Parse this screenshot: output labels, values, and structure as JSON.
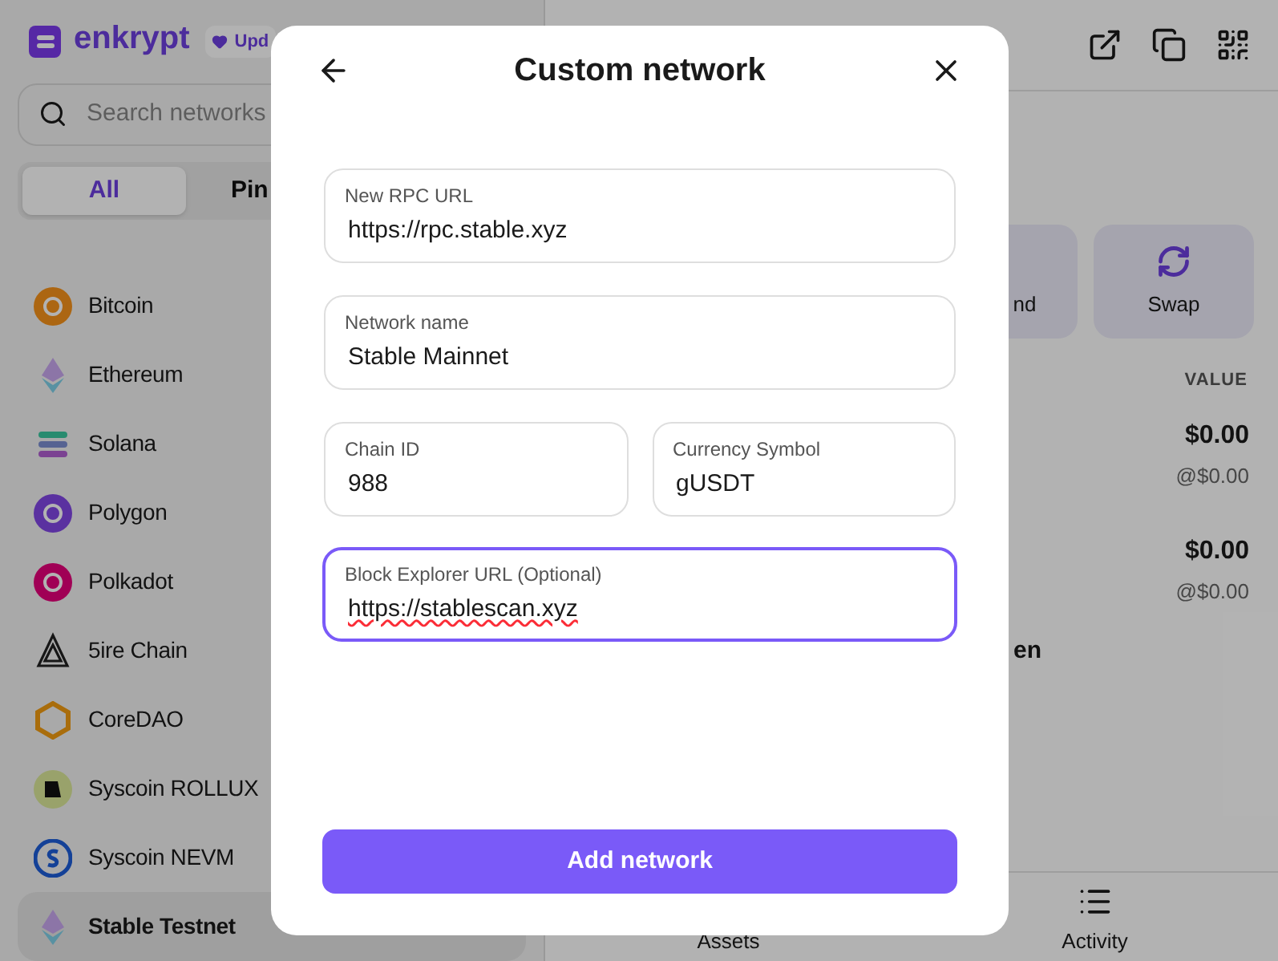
{
  "sidebar": {
    "logo": "enkrypt",
    "update_badge": "Upd",
    "search": {
      "placeholder": "Search networks"
    },
    "tabs": [
      {
        "label": "All",
        "selected": true
      },
      {
        "label": "Pin",
        "selected": false
      }
    ],
    "networks": [
      {
        "name": "Bitcoin",
        "selected": false
      },
      {
        "name": "Ethereum",
        "selected": false
      },
      {
        "name": "Solana",
        "selected": false
      },
      {
        "name": "Polygon",
        "selected": false
      },
      {
        "name": "Polkadot",
        "selected": false
      },
      {
        "name": "5ire Chain",
        "selected": false
      },
      {
        "name": "CoreDAO",
        "selected": false
      },
      {
        "name": "Syscoin ROLLUX",
        "selected": false
      },
      {
        "name": "Syscoin NEVM",
        "selected": false
      },
      {
        "name": "Stable Testnet",
        "selected": true
      }
    ]
  },
  "main": {
    "actions": [
      "nd",
      "Swap"
    ],
    "value_header": "VALUE",
    "assets": [
      {
        "value": "$0.00",
        "price": "@$0.00"
      },
      {
        "value": "$0.00",
        "price": "@$0.00"
      }
    ],
    "token_name_fragment": "en",
    "bottom_nav": [
      "Assets",
      "Activity"
    ]
  },
  "dialog": {
    "title": "Custom network",
    "rows": [
      [
        {
          "label": "New RPC URL",
          "value": "https://rpc.stable.xyz",
          "focused": false
        }
      ],
      [
        {
          "label": "Network name",
          "value": "Stable Mainnet",
          "focused": false
        }
      ],
      [
        {
          "label": "Chain ID",
          "value": "988",
          "focused": false
        },
        {
          "label": "Currency Symbol",
          "value": "gUSDT",
          "focused": false
        }
      ],
      [
        {
          "label": "Block Explorer URL (Optional)",
          "value": "https://stablescan.xyz",
          "focused": true
        }
      ]
    ],
    "submit": "Add network"
  }
}
